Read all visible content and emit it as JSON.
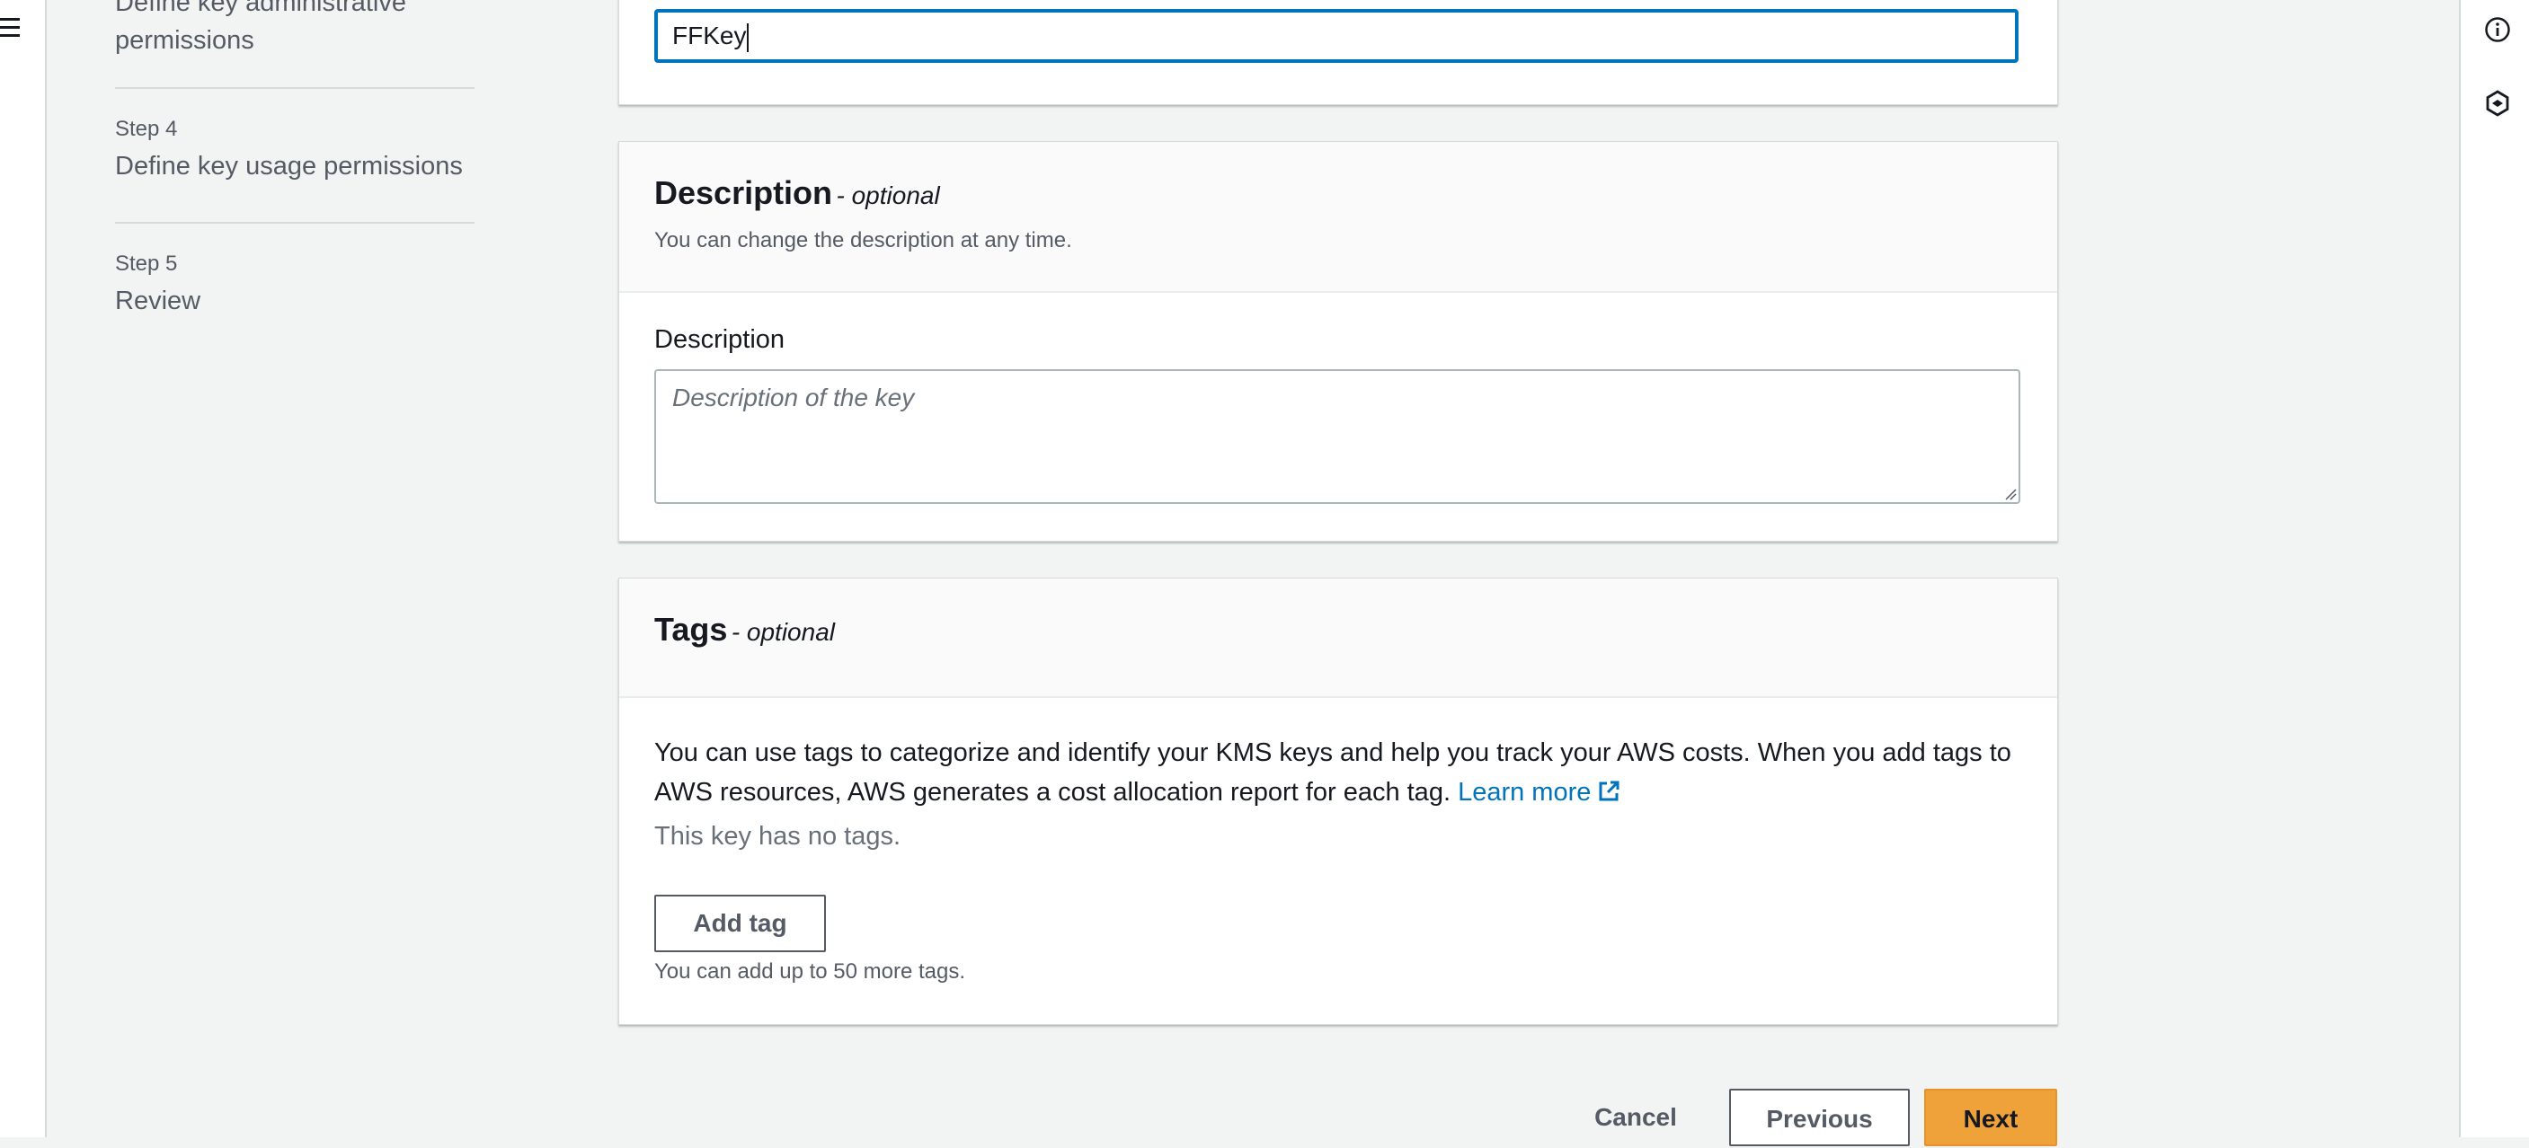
{
  "nav": {
    "steps": [
      {
        "title_line1": "Define key administrative",
        "title_line2": "permissions"
      },
      {
        "label": "Step 4",
        "title": "Define key usage permissions"
      },
      {
        "label": "Step 5",
        "title": "Review"
      }
    ]
  },
  "alias": {
    "value": "FFKey"
  },
  "description_panel": {
    "title": "Description",
    "optional": "- optional",
    "subtitle": "You can change the description at any time.",
    "field_label": "Description",
    "placeholder": "Description of the key"
  },
  "tags_panel": {
    "title": "Tags",
    "optional": "- optional",
    "body_line1": "You can use tags to categorize and identify your KMS keys and help you track your AWS costs. When you add tags to",
    "body_line2": "AWS resources, AWS generates a cost allocation report for each tag.",
    "learn_more": "Learn more",
    "no_tags": "This key has no tags.",
    "add_tag_button": "Add tag",
    "limit_hint": "You can add up to 50 more tags."
  },
  "footer": {
    "cancel": "Cancel",
    "previous": "Previous",
    "next": "Next"
  },
  "icons": {
    "menu": "hamburger-icon",
    "info": "info-icon",
    "extension": "hexagon-icon",
    "external_link": "external-link-icon"
  },
  "colors": {
    "accent": "#0073bb",
    "primary_button": "#f0a23a"
  }
}
